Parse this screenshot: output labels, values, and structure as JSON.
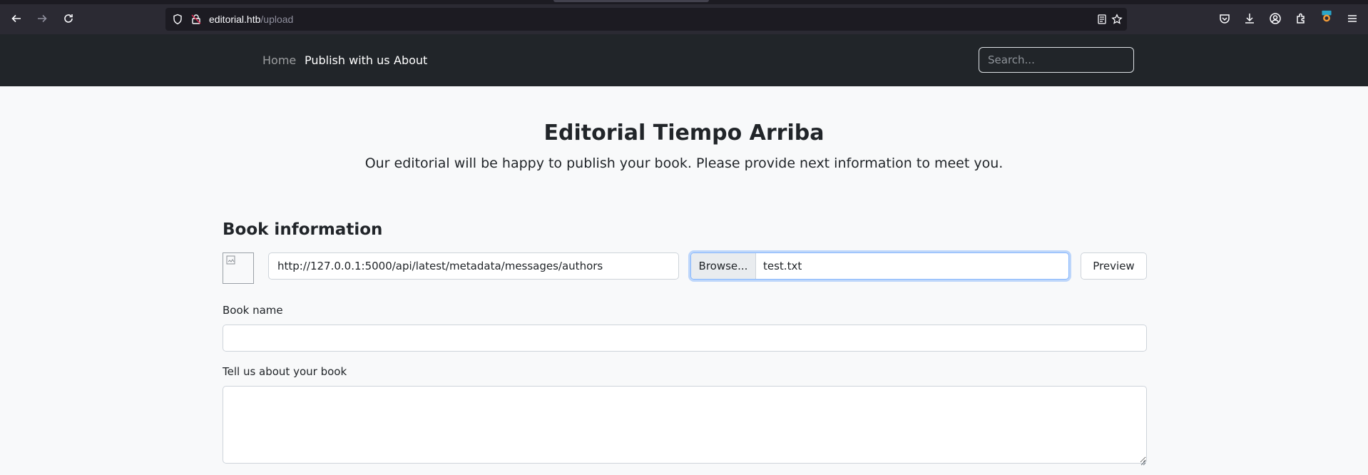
{
  "browser": {
    "url_host": "editorial.htb",
    "url_path": "/upload"
  },
  "navbar": {
    "links": [
      {
        "label": "Home",
        "state": "muted"
      },
      {
        "label": "Publish with us",
        "state": "active"
      },
      {
        "label": "About",
        "state": "active"
      }
    ],
    "search_placeholder": "Search..."
  },
  "hero": {
    "title": "Editorial Tiempo Arriba",
    "subtitle": "Our editorial will be happy to publish your book. Please provide next information to meet you."
  },
  "form": {
    "section_title": "Book information",
    "cover_url_value": "http://127.0.0.1:5000/api/latest/metadata/messages/authors",
    "browse_label": "Browse...",
    "file_name": "test.txt",
    "preview_label": "Preview",
    "book_name_label": "Book name",
    "book_name_value": "",
    "about_label": "Tell us about your book",
    "about_value": ""
  },
  "colors": {
    "navbar_bg": "#212529",
    "page_bg": "#f8f9fa",
    "focus_ring": "#86b7fe"
  }
}
